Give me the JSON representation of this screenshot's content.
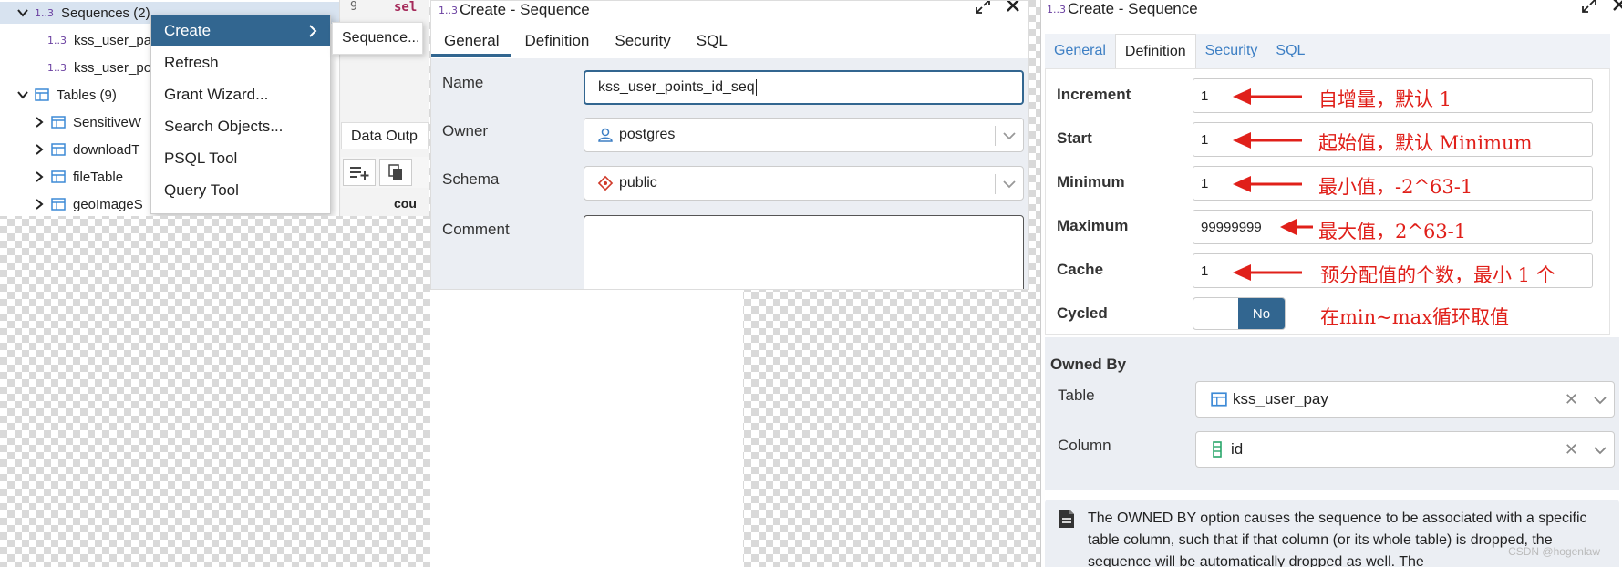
{
  "tree": {
    "sequences": {
      "icon_text": "1..3",
      "label": "Sequences (2)"
    },
    "seq_children": [
      {
        "icon_text": "1..3",
        "label": "kss_user_pa"
      },
      {
        "icon_text": "1..3",
        "label": "kss_user_po"
      }
    ],
    "tables": {
      "label": "Tables (9)"
    },
    "table_children": [
      {
        "label": "SensitiveW"
      },
      {
        "label": "downloadT"
      },
      {
        "label": "fileTable"
      },
      {
        "label": "geoImageS"
      }
    ]
  },
  "context_menu": {
    "items": [
      "Create",
      "Refresh",
      "Grant Wizard...",
      "Search Objects...",
      "PSQL Tool",
      "Query Tool"
    ],
    "submenu": "Sequence..."
  },
  "editor": {
    "line_no": "9",
    "keyword": "sel",
    "data_output_tab": "Data Outp",
    "column_cell": "cou"
  },
  "dialog_general": {
    "title_icon": "1..3",
    "title": "Create - Sequence",
    "tabs": [
      "General",
      "Definition",
      "Security",
      "SQL"
    ],
    "fields": {
      "name_label": "Name",
      "name_value": "kss_user_points_id_seq",
      "owner_label": "Owner",
      "owner_value": "postgres",
      "schema_label": "Schema",
      "schema_value": "public",
      "comment_label": "Comment"
    }
  },
  "dialog_definition": {
    "title_icon": "1..3",
    "title": "Create - Sequence",
    "tabs": [
      "General",
      "Definition",
      "Security",
      "SQL"
    ],
    "rows": [
      {
        "label": "Increment",
        "value": "1",
        "note": "自增量，默认 1"
      },
      {
        "label": "Start",
        "value": "1",
        "note": "起始值，默认 Minimum"
      },
      {
        "label": "Minimum",
        "value": "1",
        "note": "最小值，-2^63-1"
      },
      {
        "label": "Maximum",
        "value": "99999999",
        "note": "最大值，2^63-1"
      },
      {
        "label": "Cache",
        "value": "1",
        "note": "预分配值的个数，最小 1 个"
      }
    ],
    "cycled": {
      "label": "Cycled",
      "value": "No",
      "note": "在min~max循环取值"
    },
    "owned_by": {
      "title": "Owned By",
      "table_label": "Table",
      "table_value": "kss_user_pay",
      "column_label": "Column",
      "column_value": "id"
    },
    "info": "The OWNED BY option causes the sequence to be associated with a specific table column, such that if that column (or its whole table) is dropped, the sequence will be automatically dropped as well. The",
    "watermark": "CSDN @hogenlaw"
  },
  "colors": {
    "accent": "#326690",
    "annotation": "#e0201a",
    "link": "#3d7fc4"
  }
}
